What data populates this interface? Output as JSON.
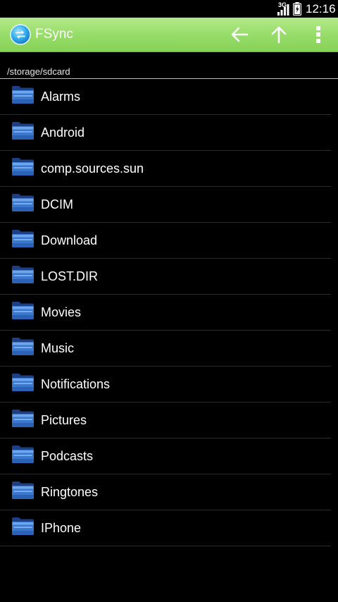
{
  "status_bar": {
    "network": "3G",
    "time": "12:16",
    "icons": [
      "signal-icon",
      "battery-icon"
    ]
  },
  "action_bar": {
    "app_name": "FSync",
    "background": "#97dd6a",
    "icons": [
      "fsync-logo-icon",
      "back-arrow-icon",
      "up-arrow-icon",
      "overflow-menu-icon"
    ]
  },
  "path": "/storage/sdcard",
  "folder_icon": "folder-icon",
  "folders": [
    {
      "name": "Alarms"
    },
    {
      "name": "Android"
    },
    {
      "name": "comp.sources.sun"
    },
    {
      "name": "DCIM"
    },
    {
      "name": "Download"
    },
    {
      "name": "LOST.DIR"
    },
    {
      "name": "Movies"
    },
    {
      "name": "Music"
    },
    {
      "name": "Notifications"
    },
    {
      "name": "Pictures"
    },
    {
      "name": "Podcasts"
    },
    {
      "name": "Ringtones"
    },
    {
      "name": "IPhone"
    }
  ]
}
